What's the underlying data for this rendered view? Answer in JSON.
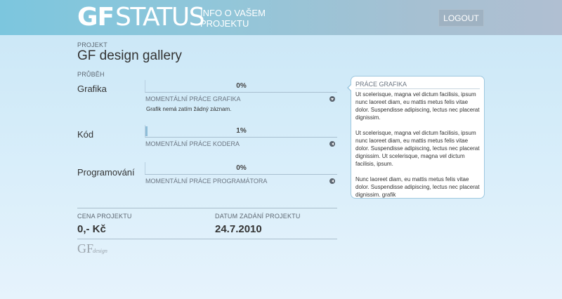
{
  "header": {
    "logo_gf": "GF",
    "logo_status": "STATUS",
    "tagline": "INFO O VAŠEM PROJEKTU",
    "logout_label": "LOGOUT"
  },
  "project": {
    "label": "PROJEKT",
    "title": "GF design gallery",
    "progress_label": "PRŮBĚH"
  },
  "tasks": [
    {
      "name": "Grafika",
      "percent_label": "0%",
      "progress": 0,
      "sub_label": "MOMENTÁLNÍ PRÁCE GRAFIKA",
      "toggle_icon": "chevron-down-icon",
      "note": "Grafik nemá zatím žádný záznam."
    },
    {
      "name": "Kód",
      "percent_label": "1%",
      "progress": 1,
      "sub_label": "MOMENTÁLNÍ PRÁCE KODERA",
      "toggle_icon": "chevron-left-icon"
    },
    {
      "name": "Programování",
      "percent_label": "0%",
      "progress": 0,
      "sub_label": "MOMENTÁLNÍ PRÁCE PROGRAMÁTORA",
      "toggle_icon": "chevron-left-icon"
    }
  ],
  "info_box": {
    "title": "PRÁCE GRAFIKA",
    "paragraphs": [
      "Ut scelerisque, magna vel dictum facilisis, ipsum nunc laoreet diam, eu mattis metus felis vitae dolor. Suspendisse adipiscing, lectus nec placerat dignissim.",
      "Ut scelerisque, magna vel dictum facilisis, ipsum nunc laoreet diam, eu mattis metus felis vitae dolor. Suspendisse adipiscing, lectus nec placerat dignissim. Ut scelerisque, magna vel dictum facilisis, ipsum.",
      "Nunc laoreet diam, eu mattis metus felis vitae dolor. Suspendisse adipiscing, lectus nec placerat dignissim. grafik"
    ]
  },
  "summary": {
    "price_label": "CENA PROJEKTU",
    "price_value": "0,- Kč",
    "date_label": "DATUM ZADÁNÍ PROJEKTU",
    "date_value": "24.7.2010"
  },
  "footer": {
    "logo_gf": "GF",
    "logo_design": "design"
  },
  "colors": {
    "header_start": "#7cc6de",
    "header_end": "#b0bfd2",
    "background": "#d4ecf9",
    "bar_fill": "#8fbdd8",
    "logout_bg": "#9fb2c2"
  }
}
